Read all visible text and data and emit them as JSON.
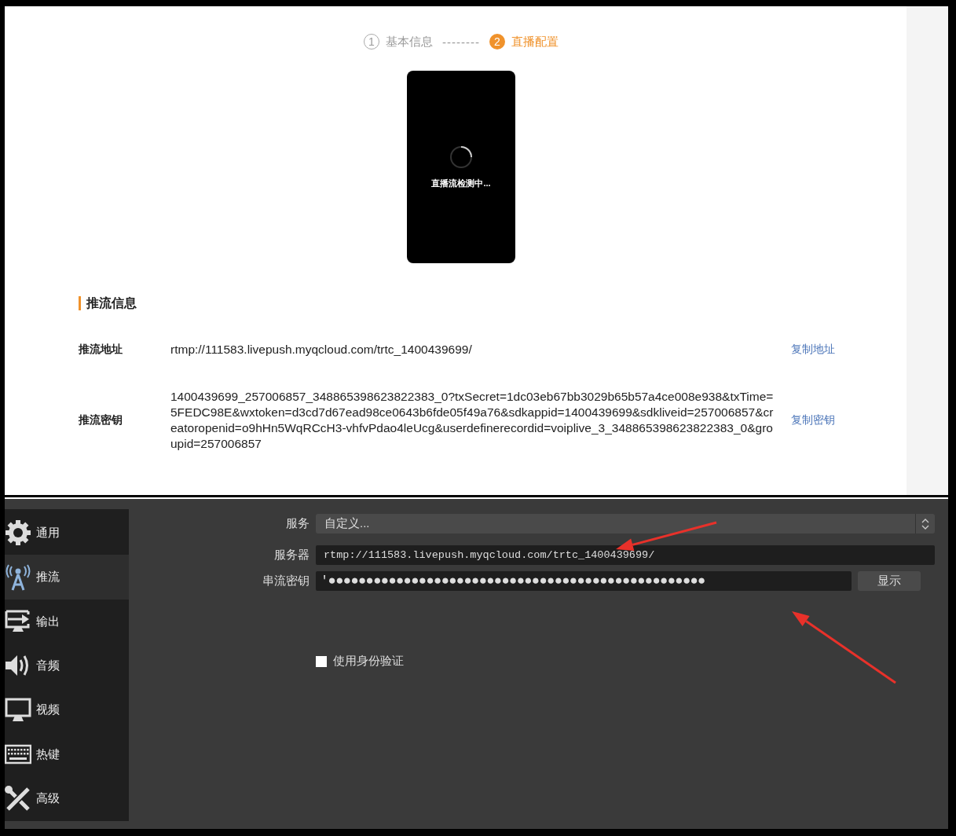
{
  "steps": [
    {
      "number": "1",
      "label": "基本信息",
      "selected": false
    },
    {
      "number": "2",
      "label": "直播配置",
      "selected": true
    }
  ],
  "step_separator": "--------",
  "preview": {
    "status": "直播流检测中..."
  },
  "push_info": {
    "title": "推流信息",
    "rows": [
      {
        "label": "推流地址",
        "value": "rtmp://111583.livepush.myqcloud.com/trtc_1400439699/",
        "action": "复制地址"
      },
      {
        "label": "推流密钥",
        "value": "1400439699_257006857_348865398623822383_0?txSecret=1dc03eb67bb3029b65b57a4ce008e938&txTime=5FEDC98E&wxtoken=d3cd7d67ead98ce0643b6fde05f49a76&sdkappid=1400439699&sdkliveid=257006857&creatoropenid=o9hHn5WqRCcH3-vhfvPdao4leUcg&userdefinerecordid=voiplive_3_348865398623822383_0&groupid=257006857",
        "action": "复制密钥"
      }
    ]
  },
  "settings": {
    "sidebar": {
      "items": [
        {
          "kind": "gear",
          "label": "通用",
          "selected": false
        },
        {
          "kind": "antenna",
          "label": "推流",
          "selected": true
        },
        {
          "kind": "output",
          "label": "输出",
          "selected": false
        },
        {
          "kind": "speaker",
          "label": "音频",
          "selected": false
        },
        {
          "kind": "monitor",
          "label": "视频",
          "selected": false
        },
        {
          "kind": "keyboard",
          "label": "热键",
          "selected": false
        },
        {
          "kind": "tools",
          "label": "高级",
          "selected": false
        }
      ]
    },
    "service": {
      "label": "服务",
      "value": "自定义..."
    },
    "server": {
      "label": "服务器",
      "value": "rtmp://111583.livepush.myqcloud.com/trtc_1400439699/"
    },
    "stream_key": {
      "label": "串流密钥",
      "value": "'●●●●●●●●●●●●●●●●●●●●●●●●●●●●●●●●●●●●●●●●●●●●●●●●●●",
      "button": "显示"
    },
    "auth": {
      "label": "使用身份验证",
      "checked": false
    }
  },
  "annotations": [
    {
      "kind": "arrow"
    },
    {
      "kind": "arrow"
    }
  ]
}
